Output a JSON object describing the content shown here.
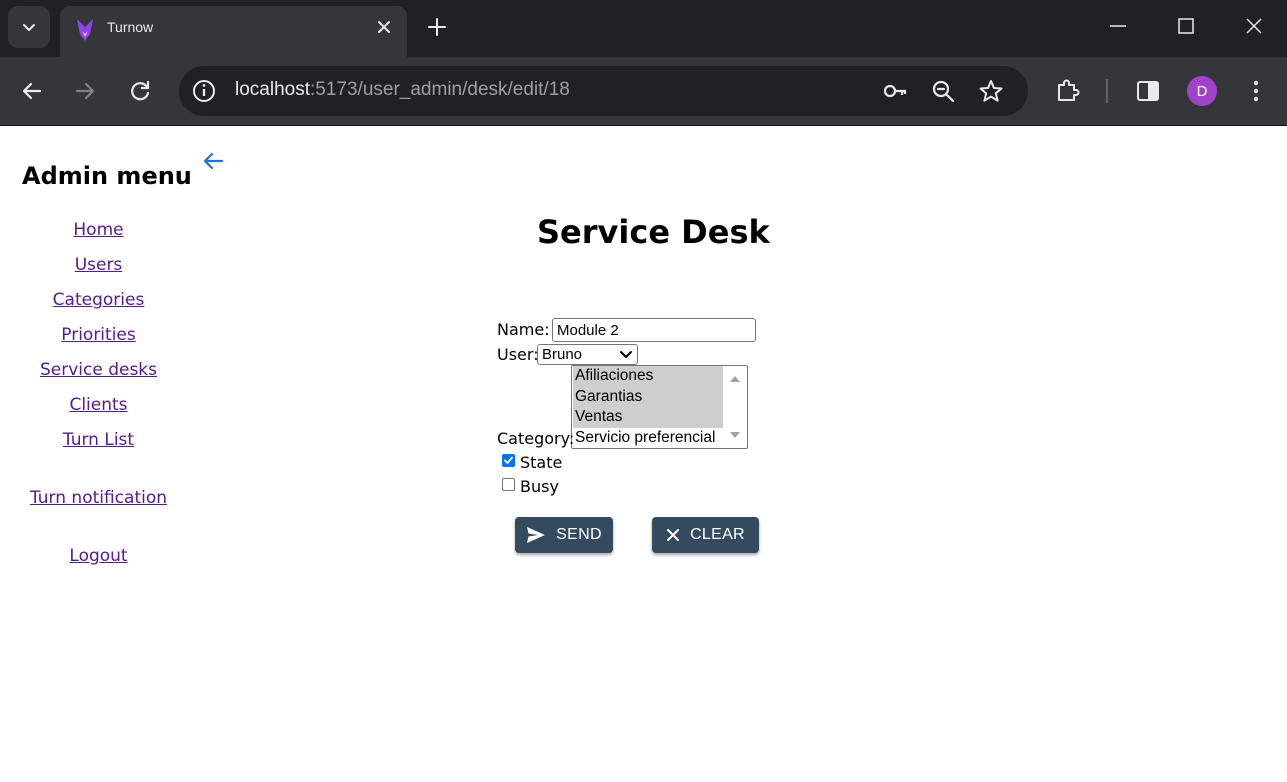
{
  "browser": {
    "tab_title": "Turnow",
    "url_host": "localhost",
    "url_path": ":5173/user_admin/desk/edit/18",
    "profile_initial": "D"
  },
  "sidebar": {
    "title": "Admin menu",
    "links": [
      "Home",
      "Users",
      "Categories",
      "Priorities",
      "Service desks",
      "Clients",
      "Turn List"
    ],
    "turn_notification": "Turn notification",
    "logout": "Logout"
  },
  "page": {
    "title": "Service Desk"
  },
  "form": {
    "name_label": "Name:",
    "name_value": "Module 2",
    "user_label": "User:",
    "user_value": "Bruno",
    "category_label": "Category:",
    "category_options": [
      {
        "label": "Afiliaciones",
        "selected": true
      },
      {
        "label": "Garantias",
        "selected": true
      },
      {
        "label": "Ventas",
        "selected": true
      },
      {
        "label": "Servicio preferencial",
        "selected": false
      }
    ],
    "state_label": "State",
    "state_checked": true,
    "busy_label": "Busy",
    "busy_checked": false,
    "send_label": "SEND",
    "clear_label": "CLEAR"
  },
  "colors": {
    "button_bg": "#344a5e",
    "link": "#551a8b",
    "back_arrow": "#1976d2",
    "checkbox_checked": "#0075ff",
    "avatar": "#a142c9"
  }
}
